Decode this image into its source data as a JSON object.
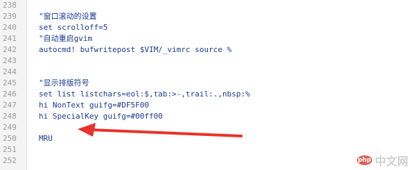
{
  "lines": [
    {
      "num": "238",
      "text": ""
    },
    {
      "num": "239",
      "text": "\"窗口滚动的设置"
    },
    {
      "num": "240",
      "text": "set scrolloff=5"
    },
    {
      "num": "241",
      "text": "\"自动重启gvim"
    },
    {
      "num": "242",
      "text": "autocmd! bufwritepost $VIM/_vimrc source %"
    },
    {
      "num": "243",
      "text": ""
    },
    {
      "num": "244",
      "text": ""
    },
    {
      "num": "245",
      "text": "\"显示排版符号"
    },
    {
      "num": "246",
      "text": "set list listchars=eol:$,tab:>-,trail:.,nbsp:%"
    },
    {
      "num": "247",
      "text": "hi NonText guifg=#DF5F00"
    },
    {
      "num": "248",
      "text": "hi SpecialKey guifg=#00ff00"
    },
    {
      "num": "249",
      "text": ""
    },
    {
      "num": "250",
      "text": "MRU"
    },
    {
      "num": "251",
      "text": ""
    },
    {
      "num": "252",
      "text": ""
    }
  ],
  "annotation": {
    "arrow_color": "#e8322b",
    "arrow_target_line": "250"
  },
  "watermark": {
    "logo": "php",
    "text": "中文网"
  }
}
